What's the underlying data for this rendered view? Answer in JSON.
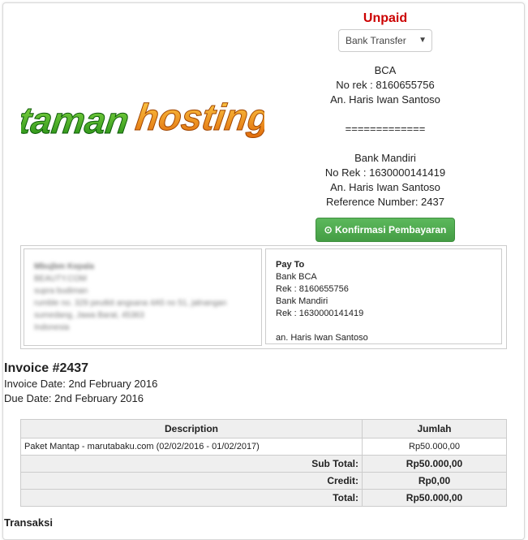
{
  "logo": {
    "part1": "taman",
    "part2": "hosting"
  },
  "status": "Unpaid",
  "payment_method": {
    "selected": "Bank Transfer"
  },
  "bank_info": {
    "bca_name": "BCA",
    "bca_rek": "No rek : 8160655756",
    "bca_holder": "An. Haris Iwan Santoso",
    "separator": "=============",
    "mandiri_name": "Bank Mandiri",
    "mandiri_rek": "No Rek : 1630000141419",
    "mandiri_holder": "An. Haris Iwan Santoso",
    "reference": "Reference Number: 2437"
  },
  "confirm_button": "Konfirmasi Pembayaran",
  "invoiced_to": [
    "Mbujbm Kepala",
    "BEAUTY.COM",
    "supra budiman",
    "rumble no. 329 peutkit angsana 4A5 no 51, jalnangan",
    "sumedang, Jawa Barat, 45363",
    "Indonesia"
  ],
  "pay_to": {
    "title": "Pay To",
    "lines": [
      "Bank BCA",
      "Rek : 8160655756",
      "Bank Mandiri",
      "Rek : 1630000141419",
      "",
      "an. Haris Iwan Santoso"
    ]
  },
  "invoice": {
    "title": "Invoice #2437",
    "date": "Invoice Date: 2nd February 2016",
    "due": "Due Date: 2nd February 2016"
  },
  "table": {
    "headers": {
      "description": "Description",
      "amount": "Jumlah"
    },
    "rows": [
      {
        "description": "Paket Mantap - marutabaku.com (02/02/2016 - 01/02/2017)",
        "amount": "Rp50.000,00"
      }
    ],
    "subtotal": {
      "label": "Sub Total:",
      "value": "Rp50.000,00"
    },
    "credit": {
      "label": "Credit:",
      "value": "Rp0,00"
    },
    "total": {
      "label": "Total:",
      "value": "Rp50.000,00"
    }
  },
  "transactions_title": "Transaksi",
  "colors": {
    "status": "#cc0000",
    "button": "#5cb85c",
    "logo_green": "#2fa81f",
    "logo_orange": "#f0a010"
  }
}
